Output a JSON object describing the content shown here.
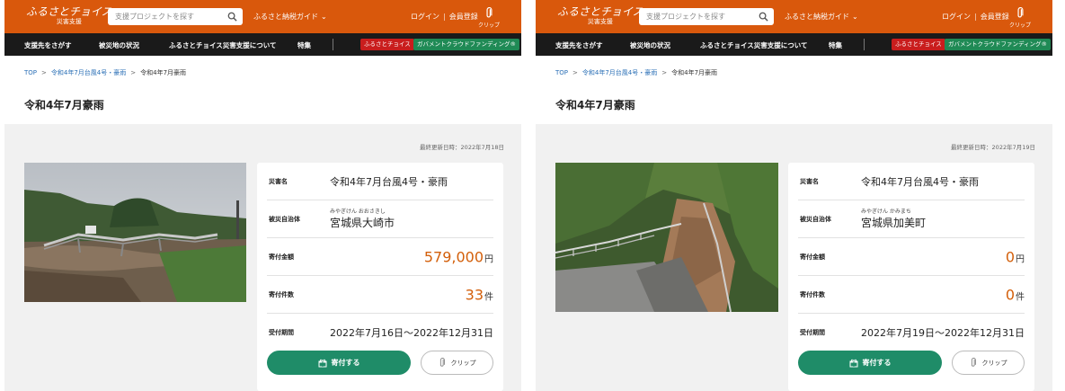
{
  "header": {
    "logo_main": "ふるさとチョイス",
    "logo_sub": "災害支援",
    "search_placeholder": "支援プロジェクトを探す",
    "guide": "ふるさと納税ガイド",
    "login": "ログイン",
    "auth_sep": "|",
    "register": "会員登録",
    "clip": "クリップ"
  },
  "nav": {
    "items": [
      "支援先をさがす",
      "被災地の状況",
      "ふるさとチョイス災害支援について",
      "特集"
    ],
    "badge_red": "ふるさとチョイス",
    "badge_green": "ガバメントクラウドファンディング®"
  },
  "breadcrumb": {
    "top": "TOP",
    "sep": ">",
    "parent": "令和4年7月台風4号・豪雨",
    "current": "令和4年7月豪雨"
  },
  "page_title": "令和4年7月豪雨",
  "labels": {
    "disaster": "災害名",
    "municipality": "被災自治体",
    "amount": "寄付金額",
    "count": "寄付件数",
    "period": "受付期間",
    "yen": "円",
    "ken": "件",
    "donate": "寄付する",
    "clip": "クリップ"
  },
  "projects": [
    {
      "updated": "最終更新日時：2022年7月18日",
      "disaster": "令和4年7月台風4号・豪雨",
      "ruby": "みやぎけん おおさきし",
      "municipality": "宮城県大崎市",
      "amount": "579,000",
      "count": "33",
      "period": "2022年7月16日〜2022年12月31日"
    },
    {
      "updated": "最終更新日時：2022年7月19日",
      "disaster": "令和4年7月台風4号・豪雨",
      "ruby": "みやぎけん かみまち",
      "municipality": "宮城県加美町",
      "amount": "0",
      "count": "0",
      "period": "2022年7月19日〜2022年12月31日"
    }
  ],
  "colors": {
    "brand": "#d9580c",
    "nav": "#1a1a1a",
    "donate": "#1f8c68",
    "amount": "#d35f0a"
  }
}
